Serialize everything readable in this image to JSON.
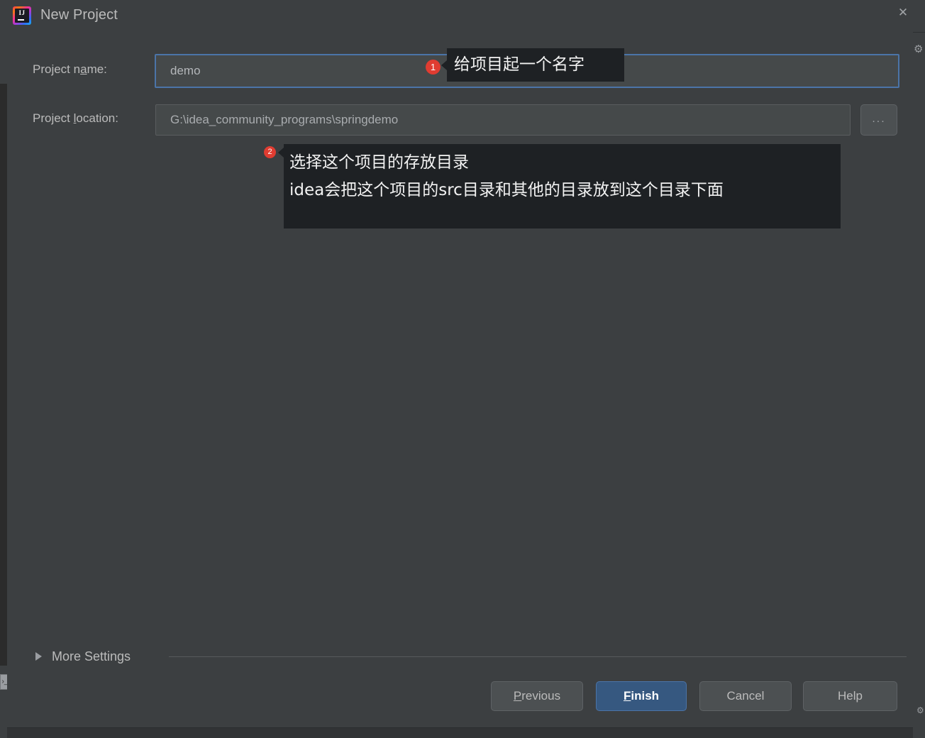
{
  "window": {
    "title": "New Project",
    "logo_icon": "intellij-idea-logo-icon",
    "close_icon": "close-icon"
  },
  "form": {
    "project_name": {
      "label_prefix": "Project n",
      "label_mnemonic": "a",
      "label_suffix": "me:",
      "value": "demo"
    },
    "project_location": {
      "label_prefix": "Project ",
      "label_mnemonic": "l",
      "label_suffix": "ocation:",
      "value": "G:\\idea_community_programs\\springdemo",
      "browse_label": "..."
    }
  },
  "annotations": [
    {
      "badge": "1",
      "lines": [
        "给项目起一个名字"
      ],
      "badge_color": "#e03c31",
      "background": "#1e2124"
    },
    {
      "badge": "2",
      "lines": [
        "选择这个项目的存放目录",
        "idea会把这个项目的src目录和其他的目录放到这个目录下面"
      ],
      "badge_color": "#e03c31",
      "background": "#1e2124"
    }
  ],
  "more_settings": {
    "label_prefix": "Mor",
    "label_mnemonic": "e",
    "label_suffix": " Settings",
    "expander_icon": "triangle-right-icon",
    "expanded": false
  },
  "buttons": {
    "previous": {
      "mnemonic": "P",
      "rest": "revious"
    },
    "finish": {
      "mnemonic": "F",
      "rest": "inish",
      "default": true,
      "accent": "#365880"
    },
    "cancel": {
      "label": "Cancel"
    },
    "help": {
      "label": "Help"
    }
  },
  "background": {
    "gear_icon": "gear-icon",
    "left_tool_icon": "terminal-icon",
    "right_bottom_icon": "gear-icon"
  },
  "colors": {
    "dialog_bg": "#3c3f41",
    "field_bg": "#45494a",
    "focus_border": "#4b74a8",
    "text": "#bbbbbb"
  }
}
